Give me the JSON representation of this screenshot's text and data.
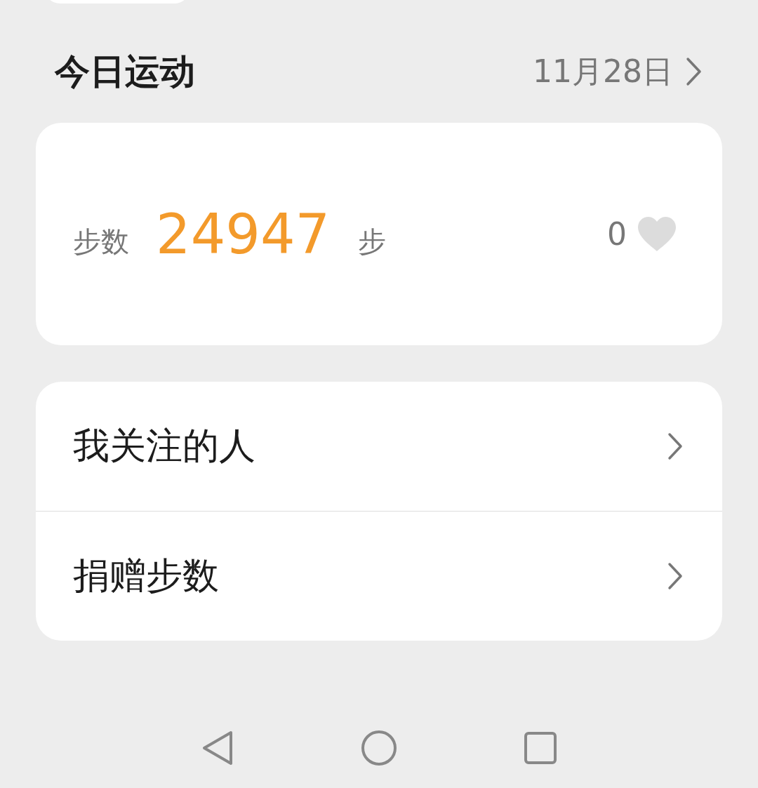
{
  "header": {
    "title": "今日运动",
    "date": "11月28日"
  },
  "steps_card": {
    "label": "步数",
    "value": "24947",
    "unit": "步",
    "likes": "0",
    "liked": false
  },
  "menu": [
    {
      "label": "我关注的人"
    },
    {
      "label": "捐赠步数"
    }
  ],
  "nav_bar": {
    "buttons": [
      {
        "kind": "back"
      },
      {
        "kind": "home"
      },
      {
        "kind": "recent"
      }
    ]
  }
}
